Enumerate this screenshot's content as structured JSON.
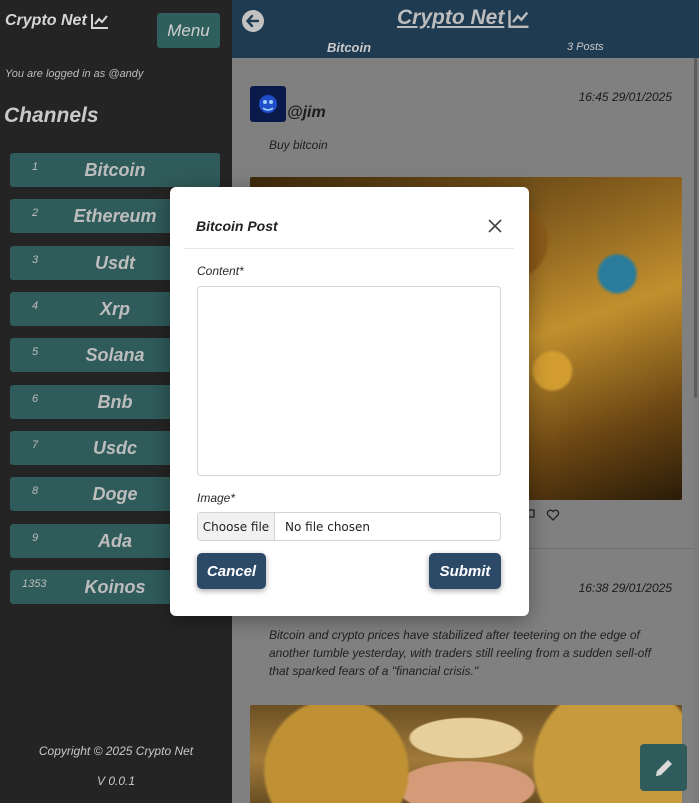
{
  "sidebar": {
    "brand": "Crypto Net",
    "menu_label": "Menu",
    "logged_in_text": "You are logged in as @andy",
    "channels_heading": "Channels",
    "channels": [
      {
        "num": "1",
        "name": "Bitcoin"
      },
      {
        "num": "2",
        "name": "Ethereum"
      },
      {
        "num": "3",
        "name": "Usdt"
      },
      {
        "num": "4",
        "name": "Xrp"
      },
      {
        "num": "5",
        "name": "Solana"
      },
      {
        "num": "6",
        "name": "Bnb"
      },
      {
        "num": "7",
        "name": "Usdc"
      },
      {
        "num": "8",
        "name": "Doge"
      },
      {
        "num": "9",
        "name": "Ada"
      },
      {
        "num": "1353",
        "name": "Koinos"
      }
    ],
    "copyright": "Copyright © 2025 Crypto Net",
    "version": "V 0.0.1"
  },
  "header": {
    "title": "Crypto Net",
    "channel": "Bitcoin",
    "posts_count": "3 Posts"
  },
  "feed": {
    "posts": [
      {
        "author": "@jim",
        "time": "16:45 29/01/2025",
        "text": "Buy bitcoin"
      },
      {
        "author": "",
        "time": "16:38 29/01/2025",
        "text": "Bitcoin and crypto prices have stabilized after teetering on the edge of another tumble yesterday, with traders still reeling from a sudden sell-off that sparked fears of a \"financial crisis.\""
      }
    ]
  },
  "modal": {
    "title": "Bitcoin Post",
    "content_label": "Content*",
    "image_label": "Image*",
    "choose_file": "Choose file",
    "no_file": "No file chosen",
    "cancel": "Cancel",
    "submit": "Submit"
  },
  "colors": {
    "sidebar_bg": "#242424",
    "channel_bg": "#2f5b5a",
    "header_bg": "#1f3b52",
    "button_bg": "#2c4a68"
  }
}
